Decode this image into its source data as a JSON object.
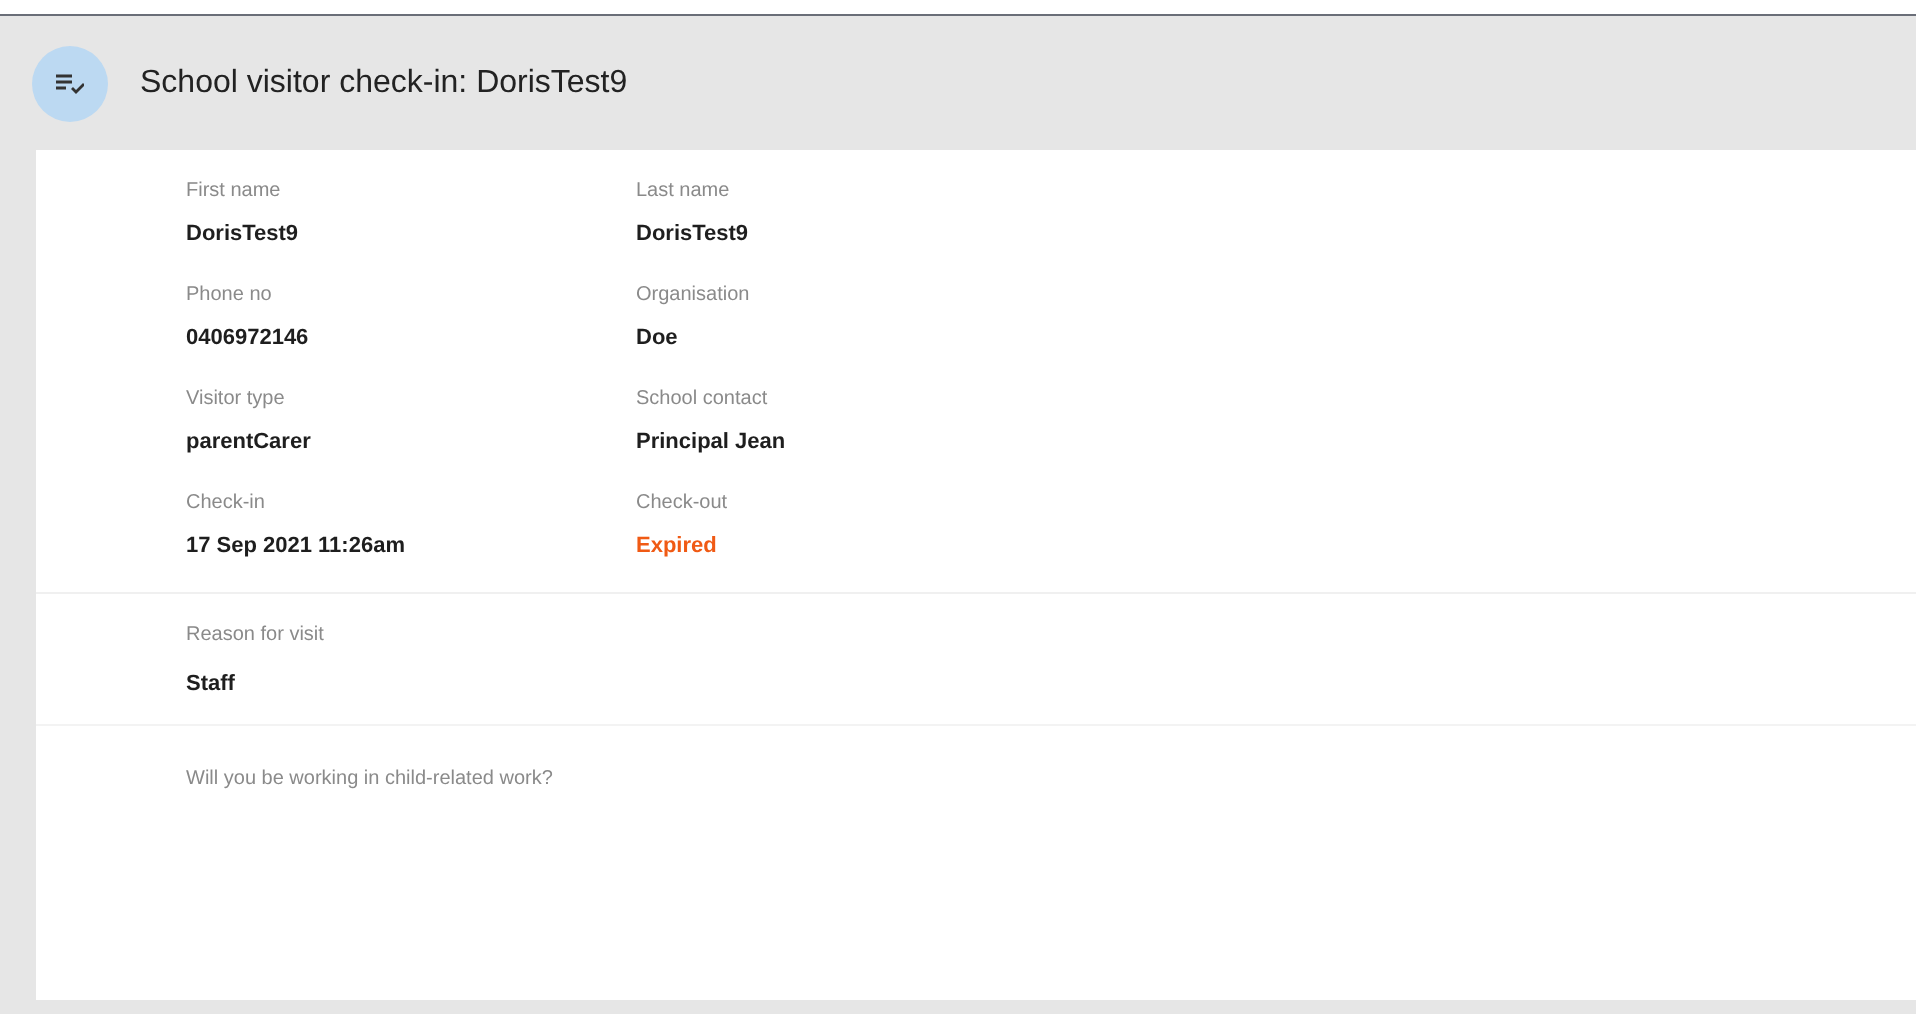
{
  "header": {
    "title": "School visitor check-in: DorisTest9"
  },
  "fields": [
    {
      "label": "First name",
      "value": "DorisTest9",
      "kind": "text"
    },
    {
      "label": "Last name",
      "value": "DorisTest9",
      "kind": "text"
    },
    {
      "label": "Phone no",
      "value": "0406972146",
      "kind": "text"
    },
    {
      "label": "Organisation",
      "value": "Doe",
      "kind": "text"
    },
    {
      "label": "Visitor type",
      "value": "parentCarer",
      "kind": "text"
    },
    {
      "label": "School contact",
      "value": "Principal Jean",
      "kind": "text"
    },
    {
      "label": "Check-in",
      "value": "17 Sep 2021 11:26am",
      "kind": "text"
    },
    {
      "label": "Check-out",
      "value": "Expired",
      "kind": "alert"
    }
  ],
  "reason": {
    "label": "Reason for visit",
    "value": "Staff"
  },
  "question": {
    "label": "Will you be working in child-related work?"
  }
}
